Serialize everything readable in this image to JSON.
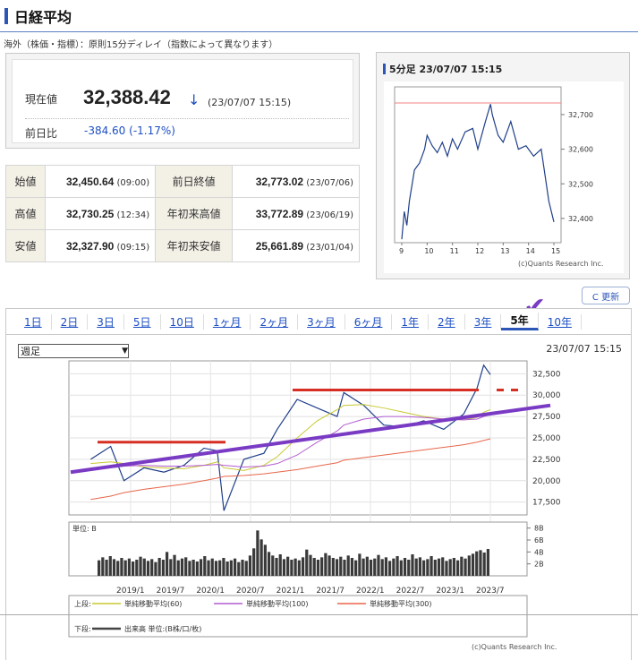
{
  "page": {
    "title": "日経平均",
    "note": "海外（株価・指標）：原則15分ディレイ（指数によって異なります）"
  },
  "quote": {
    "current_label": "現在値",
    "price": "32,388.42",
    "arrow": "↓",
    "time": "(23/07/07 15:15)",
    "change_label": "前日比",
    "change": "-384.60 (-1.17%)"
  },
  "stats": [
    [
      {
        "label": "始値",
        "value": "32,450.64",
        "note": "(09:00)"
      },
      {
        "label": "前日終値",
        "value": "32,773.02",
        "note": "(23/07/06)"
      }
    ],
    [
      {
        "label": "高値",
        "value": "32,730.25",
        "note": "(12:34)"
      },
      {
        "label": "年初来高値",
        "value": "33,772.89",
        "note": "(23/06/19)"
      }
    ],
    [
      {
        "label": "安値",
        "value": "32,327.90",
        "note": "(09:15)"
      },
      {
        "label": "年初来安値",
        "value": "25,661.89",
        "note": "(23/01/04)"
      }
    ]
  ],
  "intraday": {
    "heading": "5分足 23/07/07 15:15",
    "copyright": "(c)Quants Research Inc."
  },
  "refresh_label": "C 更新",
  "check_mark": "✔",
  "tabs": [
    "1日",
    "2日",
    "3日",
    "5日",
    "10日",
    "1ヶ月",
    "2ヶ月",
    "3ヶ月",
    "6ヶ月",
    "1年",
    "2年",
    "3年",
    "5年",
    "10年"
  ],
  "active_tab": "5年",
  "chart": {
    "period_select": "週足",
    "timestamp": "23/07/07 15:15",
    "volume_unit": "単位: B",
    "legend_top_label": "上段:",
    "legend_ma60": "単純移動平均(60)",
    "legend_ma100": "単純移動平均(100)",
    "legend_ma300": "単純移動平均(300)",
    "legend_bottom_label": "下段:",
    "legend_volume": "出来高 単位:(B株/口/枚)",
    "copyright": "(c)Quants Research Inc."
  },
  "colors": {
    "accent": "#2b56b8",
    "down": "#1d4fc3",
    "ma60": "#c8c832",
    "ma100": "#b25bd1",
    "ma300": "#e8664a",
    "annotation_red": "#d62e23",
    "annotation_purple": "#7a3bc4"
  },
  "chart_data": [
    {
      "type": "line",
      "title": "5分足 23/07/07 15:15",
      "x_ticks": [
        "9",
        "10",
        "11",
        "12",
        "13",
        "14",
        "15"
      ],
      "y_ticks": [
        "32,400",
        "32,500",
        "32,600",
        "32,700"
      ],
      "ylim": [
        32330,
        32780
      ],
      "x": [
        9.0,
        9.1,
        9.2,
        9.3,
        9.5,
        9.7,
        9.9,
        10.0,
        10.2,
        10.4,
        10.6,
        10.8,
        11.0,
        11.2,
        11.5,
        11.8,
        12.0,
        12.3,
        12.5,
        12.57,
        12.8,
        13.0,
        13.3,
        13.6,
        13.9,
        14.2,
        14.5,
        14.8,
        15.0
      ],
      "series": [
        {
          "values": [
            32340,
            32420,
            32380,
            32450,
            32540,
            32560,
            32600,
            32640,
            32610,
            32590,
            32620,
            32580,
            32630,
            32600,
            32650,
            32660,
            32600,
            32680,
            32730,
            32700,
            32640,
            32620,
            32680,
            32600,
            32610,
            32580,
            32600,
            32450,
            32390
          ]
        }
      ]
    },
    {
      "type": "line",
      "title": "",
      "x_ticks": [
        "2019/1",
        "2019/7",
        "2020/1",
        "2020/7",
        "2021/1",
        "2021/7",
        "2022/1",
        "2022/7",
        "2023/1",
        "2023/7"
      ],
      "y_ticks": [
        "17,500",
        "20,000",
        "22,500",
        "25,000",
        "27,500",
        "30,000",
        "32,500"
      ],
      "ylim": [
        16000,
        34000
      ],
      "x": [
        "2018/7",
        "2018/10",
        "2018/12",
        "2019/3",
        "2019/6",
        "2019/9",
        "2019/12",
        "2020/2",
        "2020/3",
        "2020/6",
        "2020/9",
        "2020/11",
        "2021/2",
        "2021/5",
        "2021/8",
        "2021/9",
        "2021/12",
        "2022/3",
        "2022/6",
        "2022/9",
        "2022/12",
        "2023/3",
        "2023/5",
        "2023/6",
        "2023/7"
      ],
      "series": [
        {
          "name": "日経平均",
          "values": [
            22500,
            24000,
            20000,
            21500,
            21000,
            21800,
            23800,
            23500,
            16500,
            22500,
            23200,
            26000,
            29500,
            28500,
            27500,
            30300,
            28800,
            26500,
            26300,
            27000,
            26000,
            27800,
            30800,
            33500,
            32400
          ]
        },
        {
          "name": "単純移動平均(60)",
          "values": [
            22000,
            22200,
            22000,
            21600,
            21500,
            21400,
            21800,
            22200,
            21500,
            21200,
            21800,
            22800,
            25000,
            27000,
            28300,
            28800,
            28900,
            28500,
            28000,
            27500,
            27200,
            27100,
            27400,
            28000,
            28300
          ]
        },
        {
          "name": "単純移動平均(100)",
          "values": [
            21500,
            21600,
            21700,
            21800,
            21700,
            21700,
            21800,
            21900,
            21800,
            21600,
            21700,
            22000,
            23000,
            24500,
            25800,
            26500,
            27200,
            27500,
            27500,
            27400,
            27200,
            27100,
            27200,
            27500,
            27700
          ]
        },
        {
          "name": "単純移動平均(300)",
          "values": [
            17800,
            18200,
            18600,
            19000,
            19300,
            19600,
            20000,
            20300,
            20500,
            20600,
            20800,
            21000,
            21300,
            21700,
            22100,
            22400,
            22700,
            23000,
            23300,
            23600,
            23900,
            24200,
            24500,
            24700,
            24900
          ]
        }
      ]
    },
    {
      "type": "bar",
      "title": "",
      "y_ticks": [
        "2B",
        "4B",
        "6B",
        "8B"
      ],
      "ylim": [
        0,
        9
      ],
      "series": [
        {
          "name": "出来高",
          "values": [
            2.6,
            3.1,
            2.7,
            3.3,
            2.8,
            2.5,
            3.0,
            2.6,
            2.9,
            2.4,
            2.7,
            3.2,
            2.9,
            2.5,
            2.8,
            2.3,
            3.0,
            2.7,
            4.0,
            2.8,
            3.5,
            2.6,
            2.9,
            3.1,
            2.5,
            2.7,
            2.4,
            2.8,
            3.3,
            2.6,
            2.9,
            2.5,
            2.6,
            3.0,
            2.4,
            2.6,
            2.9,
            2.3,
            2.7,
            2.5,
            3.4,
            4.6,
            7.6,
            6.1,
            5.2,
            4.0,
            3.4,
            3.0,
            3.6,
            2.8,
            3.2,
            2.7,
            2.9,
            2.6,
            3.1,
            4.4,
            3.5,
            3.0,
            2.7,
            3.1,
            3.8,
            3.4,
            3.0,
            2.8,
            3.2,
            2.7,
            3.4,
            3.0,
            2.6,
            3.7,
            2.9,
            3.2,
            2.7,
            2.9,
            3.5,
            2.8,
            3.1,
            2.5,
            2.9,
            3.3,
            2.6,
            3.0,
            2.7,
            3.6,
            2.9,
            3.1,
            2.6,
            2.8,
            3.3,
            2.7,
            2.9,
            3.1,
            2.5,
            2.8,
            3.0,
            2.6,
            3.2,
            2.9,
            3.4,
            3.7,
            4.1,
            4.3,
            3.9,
            4.5
          ]
        }
      ]
    }
  ]
}
